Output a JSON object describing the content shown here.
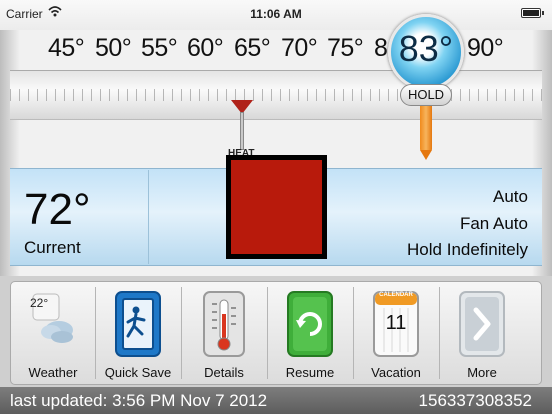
{
  "status_bar": {
    "carrier": "Carrier",
    "time": "11:06 AM"
  },
  "scale": {
    "labels": [
      "45°",
      "50°",
      "55°",
      "60°",
      "65°",
      "70°",
      "75°",
      "8",
      "90°"
    ]
  },
  "heat_marker": {
    "label": "HEAT"
  },
  "setpoint": {
    "value": "83°",
    "hold_label": "HOLD"
  },
  "current": {
    "temperature": "72°",
    "label": "Current"
  },
  "modes": {
    "system": "Auto",
    "fan": "Fan Auto",
    "hold": "Hold Indefinitely"
  },
  "heat_indicator_color": "#b81a0c",
  "dock": {
    "items": [
      {
        "label": "Weather",
        "icon": "weather-icon",
        "detail": "22°"
      },
      {
        "label": "Quick Save",
        "icon": "quick-save-icon"
      },
      {
        "label": "Details",
        "icon": "thermometer-icon"
      },
      {
        "label": "Resume",
        "icon": "resume-icon"
      },
      {
        "label": "Vacation",
        "icon": "calendar-icon",
        "detail": "CALENDAR",
        "day": "11"
      },
      {
        "label": "More",
        "icon": "chevron-right-icon"
      }
    ]
  },
  "footer": {
    "last_updated": "last updated: 3:56 PM Nov 7 2012",
    "device_id": "156337308352"
  }
}
